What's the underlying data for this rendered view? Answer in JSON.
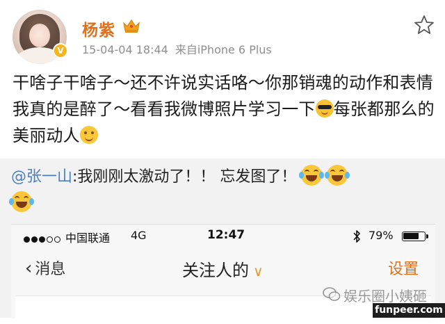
{
  "post": {
    "author": "杨紫",
    "verified_badge": "V",
    "timestamp": "15-04-04 18:44",
    "source": "来自iPhone 6 Plus",
    "text_part1": "干啥子干啥子～还不许说实话咯～你那销魂的动作和表情我真的是醉了～看看我微博照片学习一下",
    "text_part2": "每张都那么的美丽动人",
    "icons": [
      "avatar",
      "crown-icon",
      "verified-icon",
      "star-icon",
      "sunglasses-emoji",
      "smile-emoji"
    ]
  },
  "repost": {
    "mention": "@张一山",
    "comment": ":我刚刚太激动了！！ 忘发图了！",
    "emoji": "laugh-cry-emoji"
  },
  "phone": {
    "carrier": "中国联通",
    "network": "4G",
    "time": "12:47",
    "battery_pct": "79%",
    "battery_level": 0.79,
    "back_label": "消息",
    "title": "关注人的",
    "settings_label": "设置"
  },
  "watermarks": {
    "wechat": "娱乐圈小姨砸",
    "site": "funpeer.com"
  },
  "colors": {
    "author_name": "#e0701b",
    "mention": "#4a7fc1",
    "settings": "#e0701b",
    "repost_bg": "#f2f2f2"
  }
}
